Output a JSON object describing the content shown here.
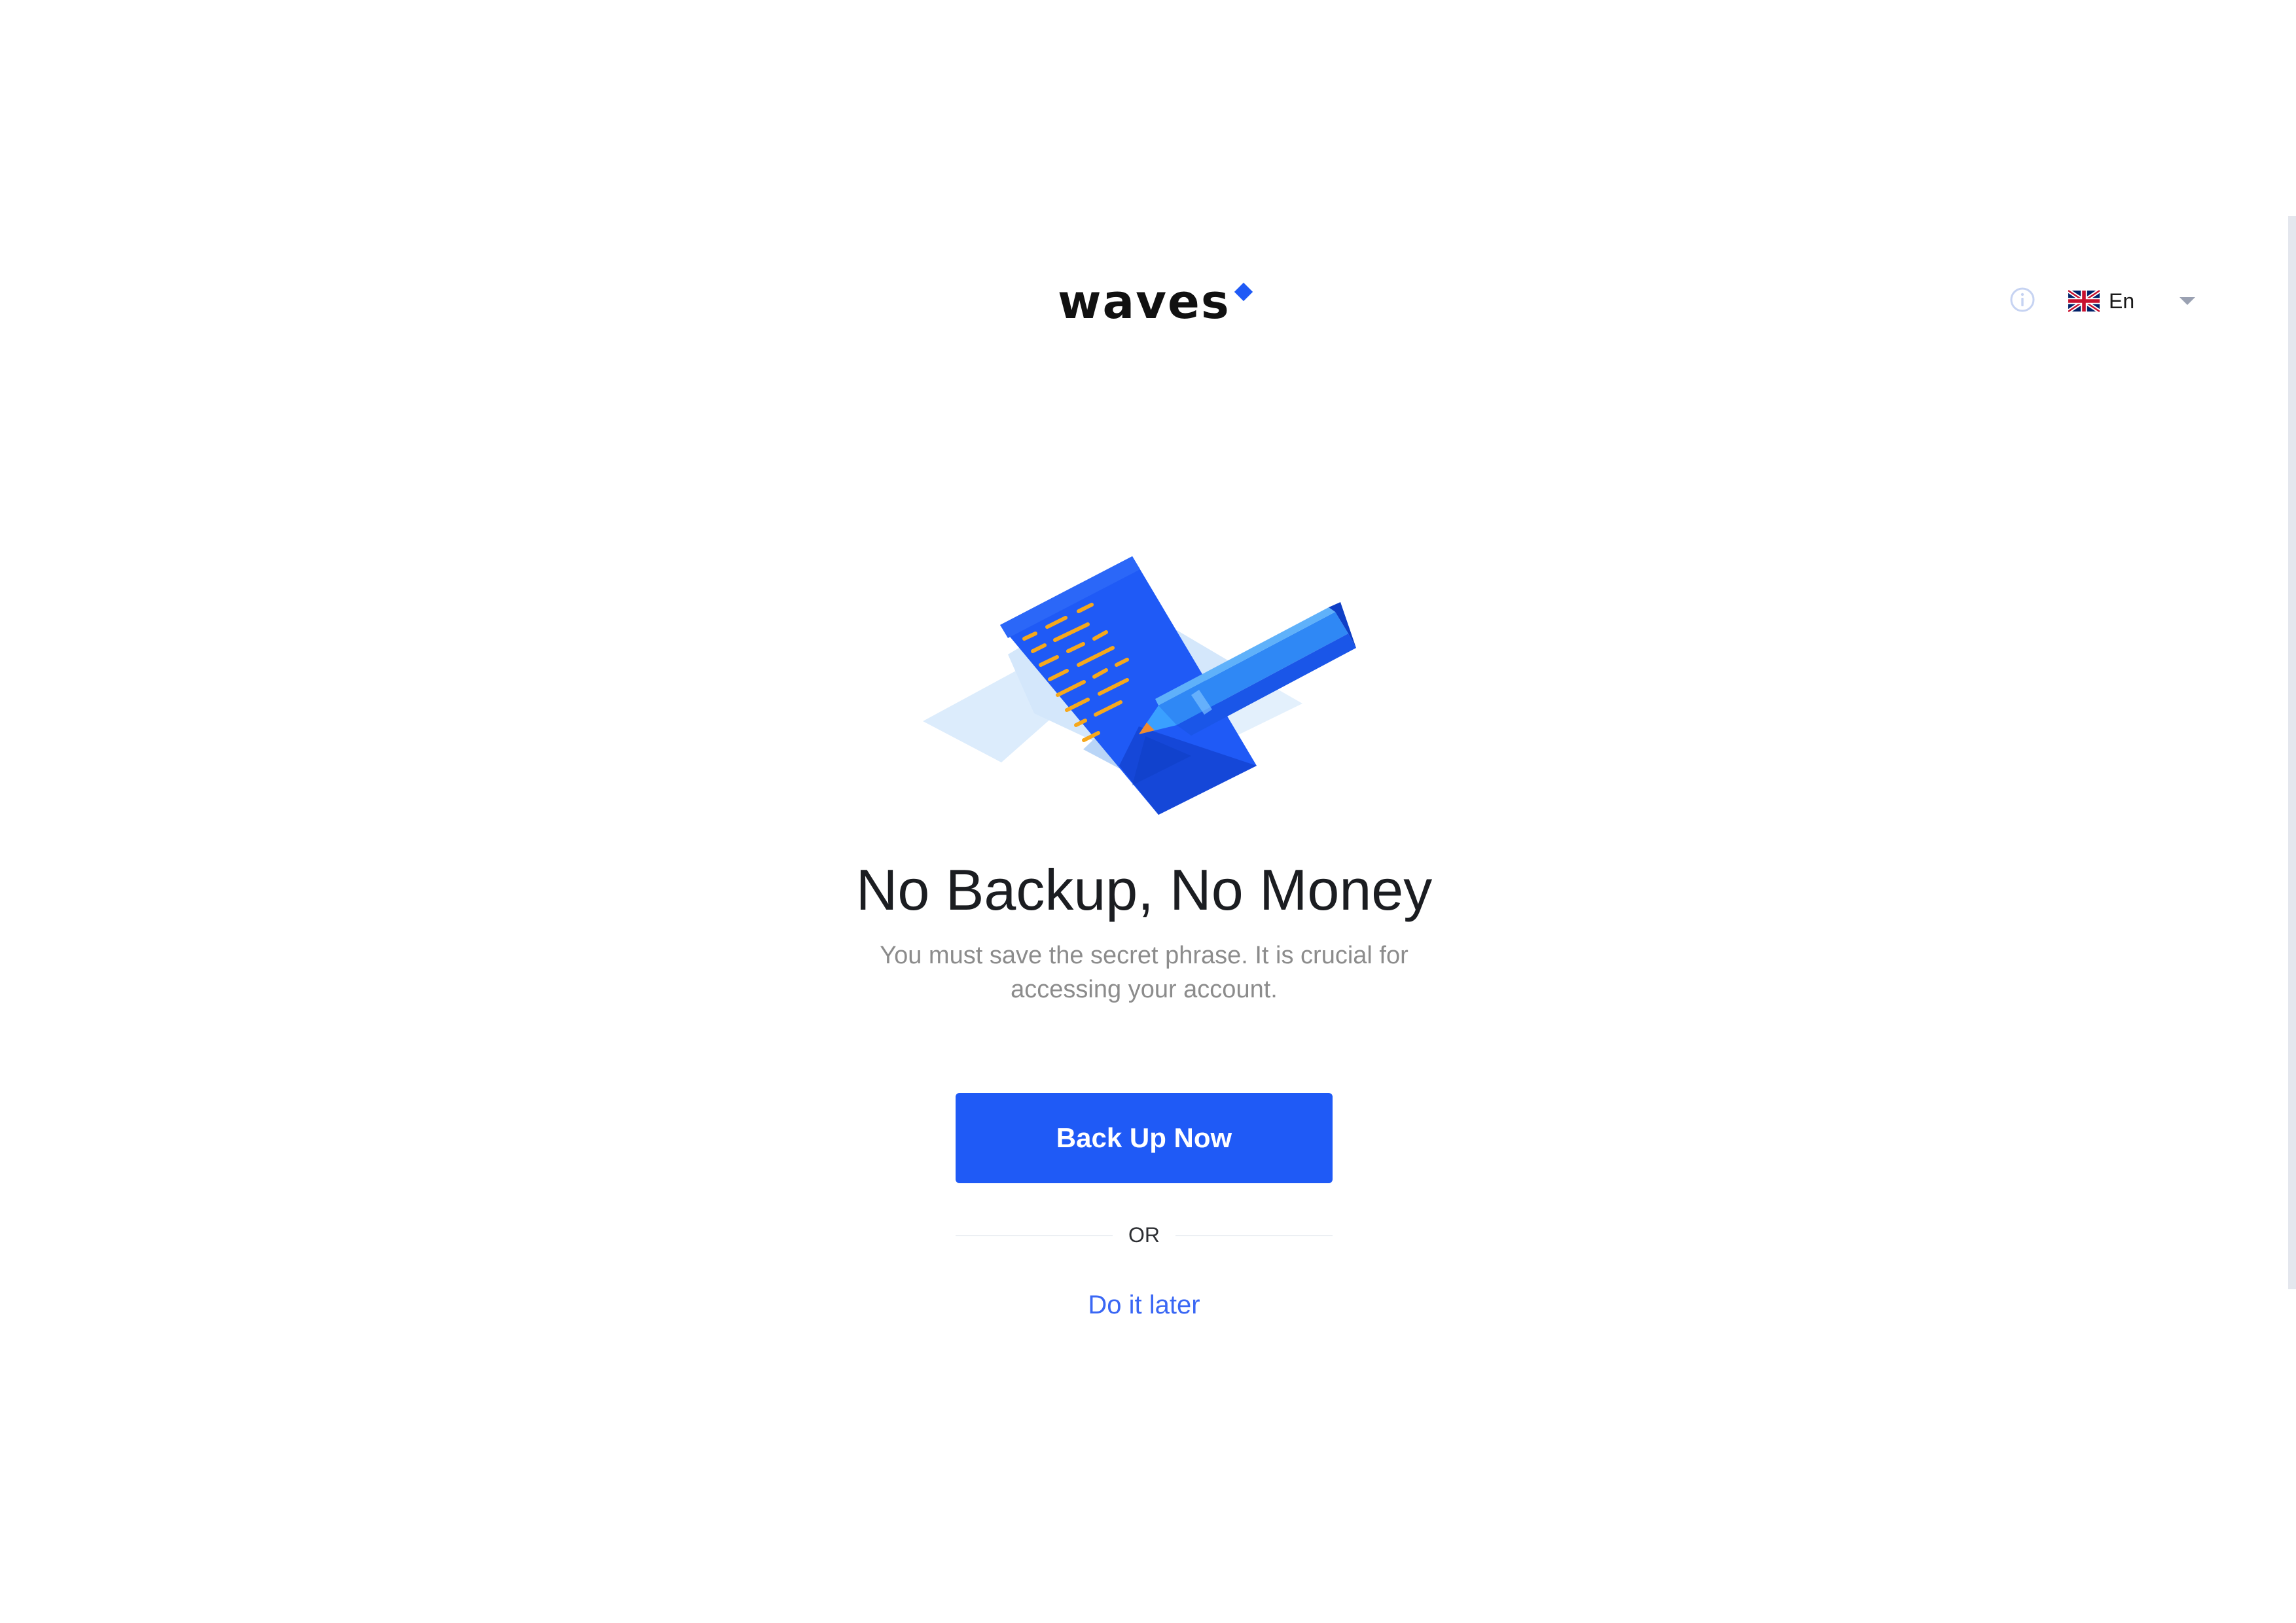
{
  "header": {
    "logo_text": "waves",
    "language_label": "En",
    "info_icon": "info-icon",
    "flag_icon": "uk-flag-icon"
  },
  "main": {
    "illustration_icon": "document-pencil-illustration",
    "title": "No Backup, No Money",
    "subtitle": "You must save the secret phrase. It is crucial for accessing your account.",
    "primary_button_label": "Back Up Now",
    "divider_text": "OR",
    "secondary_link_label": "Do it later"
  },
  "colors": {
    "accent": "#1f5af6",
    "link": "#3a67f4",
    "title": "#1b1d21",
    "subtitle": "#8c8c8c"
  }
}
